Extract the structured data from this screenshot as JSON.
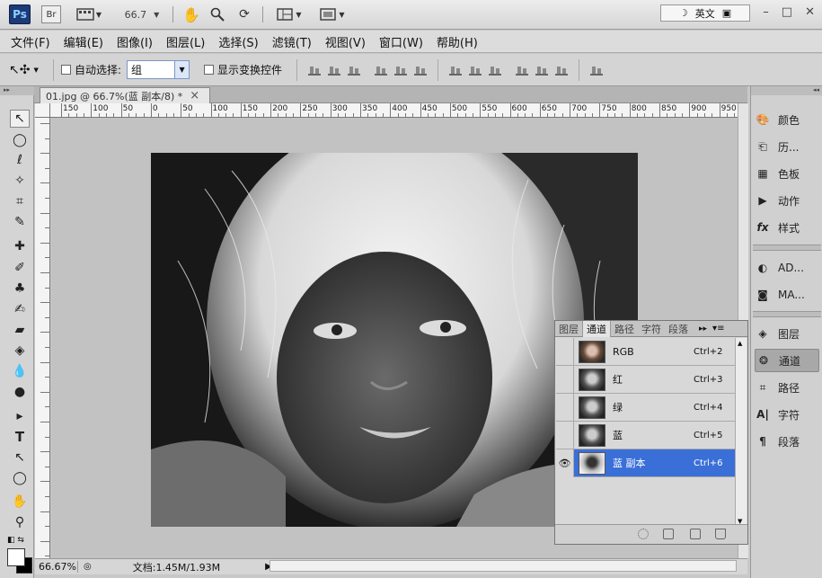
{
  "titlebar": {
    "logo": "Ps",
    "bridge": "Br",
    "zoom": "66.7",
    "ime_label": "英文",
    "window_buttons": [
      "–",
      "□",
      "✕"
    ]
  },
  "menu": [
    "文件(F)",
    "编辑(E)",
    "图像(I)",
    "图层(L)",
    "选择(S)",
    "滤镜(T)",
    "视图(V)",
    "窗口(W)",
    "帮助(H)"
  ],
  "options": {
    "auto_select_label": "自动选择:",
    "auto_select_value": "组",
    "show_transform_label": "显示变换控件"
  },
  "document": {
    "tab_title": "01.jpg @ 66.7%(蓝 副本/8) *",
    "close": "×"
  },
  "ruler": {
    "labels": [
      "150",
      "100",
      "50",
      "0",
      "50",
      "100",
      "150",
      "200",
      "250",
      "300",
      "350",
      "400",
      "450",
      "500",
      "550",
      "600",
      "650",
      "700",
      "750",
      "800",
      "850",
      "900",
      "950"
    ]
  },
  "status": {
    "zoom": "66.67%",
    "doc_info": "文档:1.45M/1.93M"
  },
  "dock": {
    "group1": [
      {
        "label": "颜色",
        "icon": "palette-icon"
      },
      {
        "label": "历...",
        "icon": "history-icon"
      },
      {
        "label": "色板",
        "icon": "swatches-icon"
      },
      {
        "label": "动作",
        "icon": "actions-icon"
      },
      {
        "label": "样式",
        "icon": "styles-icon"
      }
    ],
    "group2": [
      {
        "label": "AD...",
        "icon": "adjustments-icon"
      },
      {
        "label": "MA...",
        "icon": "masks-icon"
      }
    ],
    "group3": [
      {
        "label": "图层",
        "icon": "layers-icon"
      },
      {
        "label": "通道",
        "icon": "channels-icon"
      },
      {
        "label": "路径",
        "icon": "paths-icon"
      },
      {
        "label": "字符",
        "icon": "character-icon"
      },
      {
        "label": "段落",
        "icon": "paragraph-icon"
      }
    ]
  },
  "channels_panel": {
    "tabs": [
      "图层",
      "通道",
      "路径",
      "字符",
      "段落"
    ],
    "active_tab": "通道",
    "rows": [
      {
        "name": "RGB",
        "shortcut": "Ctrl+2"
      },
      {
        "name": "红",
        "shortcut": "Ctrl+3"
      },
      {
        "name": "绿",
        "shortcut": "Ctrl+4"
      },
      {
        "name": "蓝",
        "shortcut": "Ctrl+5"
      },
      {
        "name": "蓝 副本",
        "shortcut": "Ctrl+6"
      }
    ],
    "selected": "蓝 副本"
  }
}
